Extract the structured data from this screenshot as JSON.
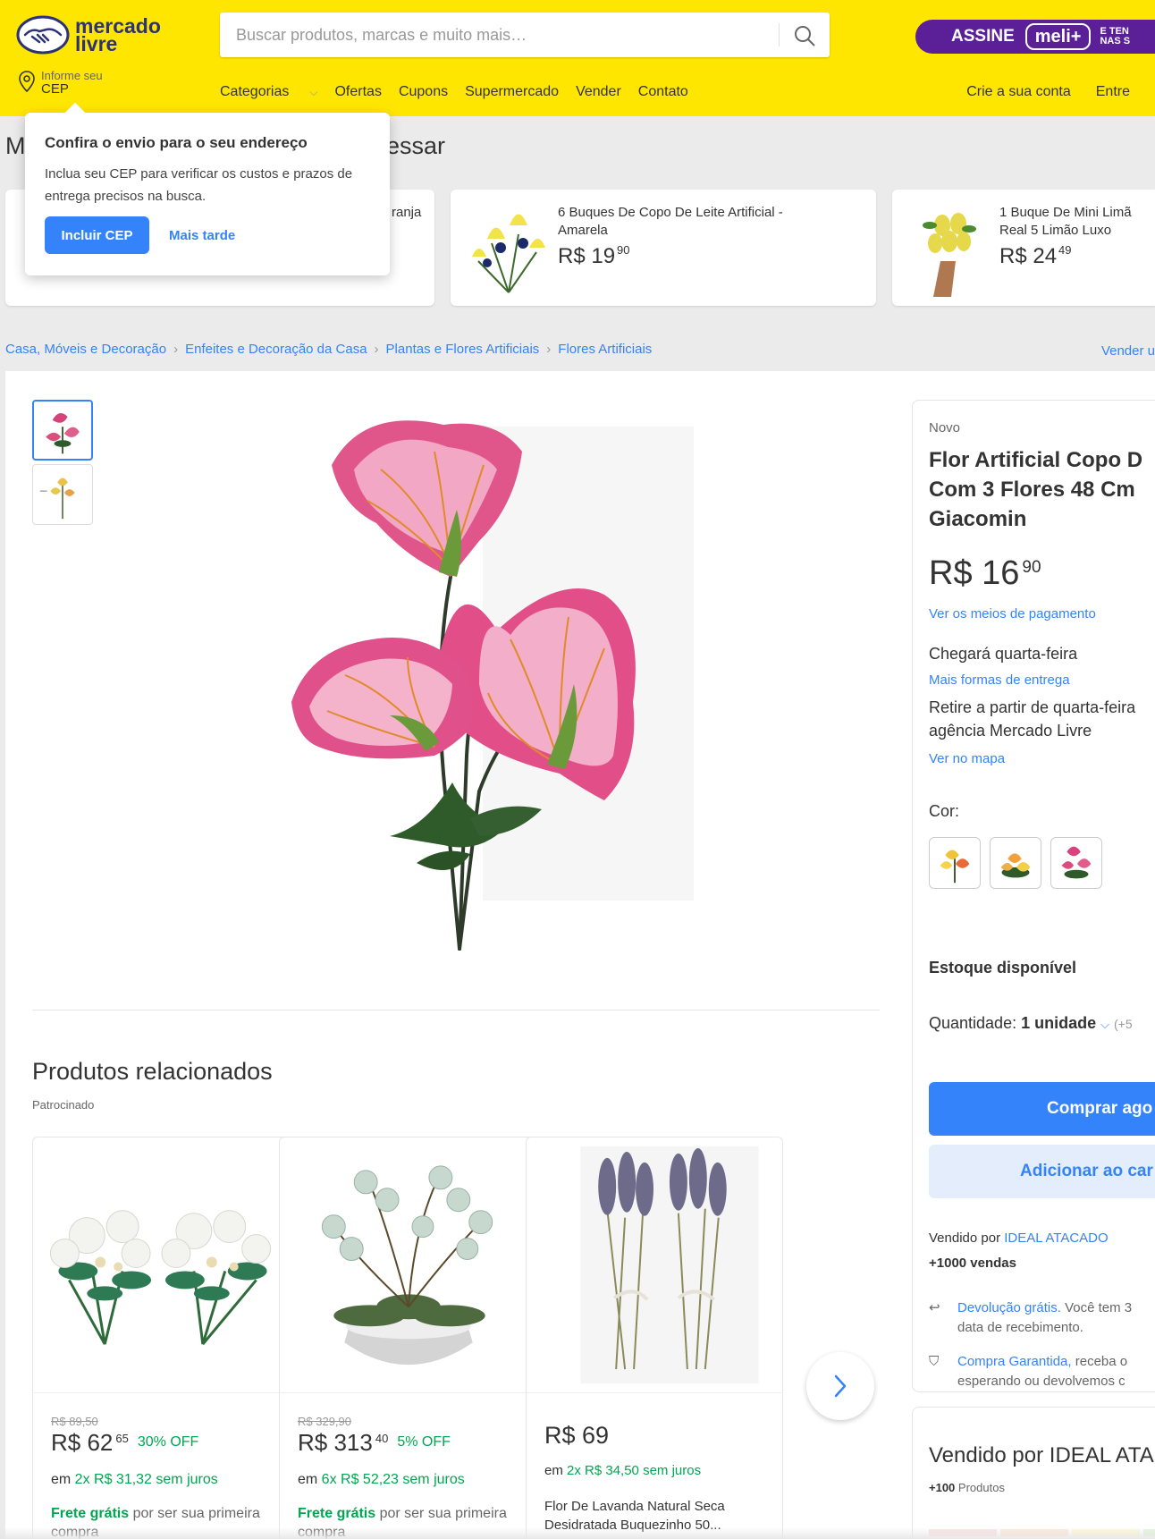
{
  "header": {
    "logo_line1": "mercado",
    "logo_line2": "livre",
    "search_placeholder": "Buscar produtos, marcas e muito mais…",
    "meli": {
      "assine": "ASSINE",
      "badge": "meli+",
      "tiny1": "E TEN",
      "tiny2": "NAS S"
    },
    "cep_line1": "Informe seu",
    "cep_line2": "CEP",
    "nav": [
      "Categorias",
      "Ofertas",
      "Cupons",
      "Supermercado",
      "Vender",
      "Contato"
    ],
    "nav_right": [
      "Crie a sua conta",
      "Entre"
    ]
  },
  "popup": {
    "title": "Confira o envio para o seu endereço",
    "description": "Inclua seu CEP para verificar os custos e prazos de entrega precisos na busca.",
    "primary": "Incluir CEP",
    "secondary": "Mais tarde"
  },
  "recent": {
    "title_left": "M",
    "title_right": "essar",
    "items": [
      {
        "name": "ranja",
        "price": "",
        "cents": ""
      },
      {
        "name": "6 Buques De Copo De Leite Artificial - Amarela",
        "price": "R$ 19",
        "cents": "90"
      },
      {
        "name": "1 Buque De Mini Limã Real 5 Limão Luxo",
        "price": "R$ 24",
        "cents": "49"
      }
    ]
  },
  "breadcrumb": [
    "Casa, Móveis e Decoração",
    "Enfeites e Decoração da Casa",
    "Plantas e Flores Artificiais",
    "Flores Artificiais"
  ],
  "vender": "Vender u",
  "product": {
    "condition": "Novo",
    "title_lines": [
      "Flor Artificial Copo D",
      "Com 3 Flores 48 Cm",
      "Giacomin"
    ],
    "price": "R$ 16",
    "cents": "90",
    "payment_link": "Ver os meios de pagamento",
    "arrival": "Chegará quarta-feira",
    "delivery_link": "Mais formas de entrega",
    "pickup_line1": "Retire a partir de quarta-feira",
    "pickup_line2": "agência Mercado Livre",
    "map_link": "Ver no mapa",
    "color_label": "Cor:",
    "stock": "Estoque disponível",
    "qty_label": "Quantidade: ",
    "qty_value": "1 unidade",
    "qty_more": "(+5",
    "buy": "Comprar ago",
    "add_cart": "Adicionar ao car",
    "sold_by_label": "Vendido por ",
    "seller": "IDEAL ATACADO",
    "sales": "+1000 vendas",
    "return_link": "Devolução grátis.",
    "return_text": " Você tem 3",
    "return_line2": "data de recebimento.",
    "guarantee_link": "Compra Garantida,",
    "guarantee_text": " receba o",
    "guarantee_line2": "esperando ou devolvemos c"
  },
  "seller_box": {
    "title": "Vendido por IDEAL ATA",
    "products_count": "+100",
    "products_label": " Produtos",
    "bar_colors": [
      "#fde2e2",
      "#ffe9d6",
      "#fff9d6",
      "#e4f5d8"
    ]
  },
  "related": {
    "title": "Produtos relacionados",
    "subtitle": "Patrocinado",
    "items": [
      {
        "old": "R$ 89,50",
        "price": "R$ 62",
        "cents": "65",
        "off": "30% OFF",
        "inst_a": "em ",
        "inst_g": "2x R$ 31,32 sem juros",
        "ship_b": "Frete grátis",
        "ship_t": " por ser sua primeira compra"
      },
      {
        "old": "R$ 329,90",
        "price": "R$ 313",
        "cents": "40",
        "off": "5% OFF",
        "inst_a": "em ",
        "inst_g": "6x R$ 52,23 sem juros",
        "ship_b": "Frete grátis",
        "ship_t": " por ser sua primeira compra"
      },
      {
        "price": "R$ 69",
        "inst_a": "em ",
        "inst_g": "2x R$ 34,50 sem juros",
        "title": "Flor De Lavanda Natural Seca Desidratada Buquezinho 50..."
      }
    ]
  },
  "colors": {
    "yellow": "#ffe600",
    "blue": "#3483fa",
    "green": "#00a650",
    "meli_purple": "#5b2098"
  }
}
